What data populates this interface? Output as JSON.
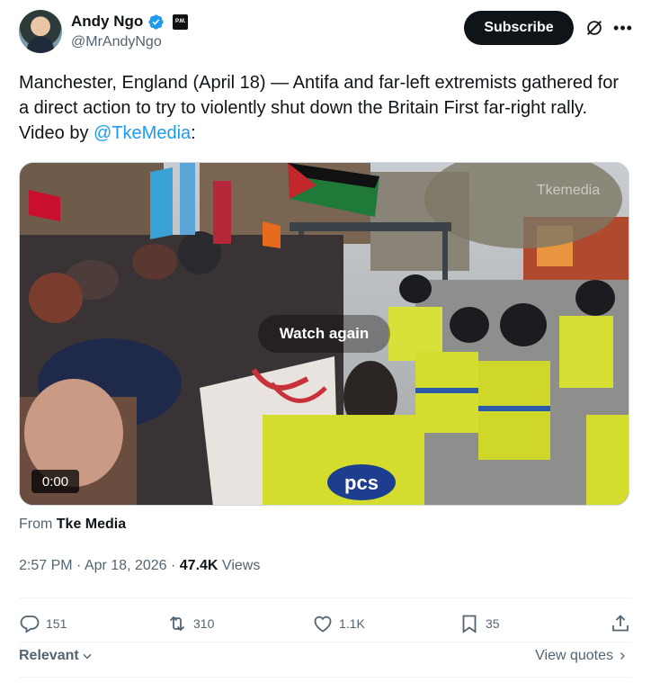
{
  "author": {
    "display_name": "Andy Ngo",
    "handle": "@MrAndyNgo",
    "affiliate_badge": "P.M."
  },
  "header": {
    "subscribe_label": "Subscribe"
  },
  "tweet": {
    "text_before_mention": "Manchester, England (April 18) — Antifa and far-left extremists gathered for a direct action to try to violently shut down the Britain First far-right rally. Video by ",
    "mention": "@TkeMedia",
    "text_after_mention": ":"
  },
  "media": {
    "watch_again_label": "Watch again",
    "duration": "0:00",
    "watermark": "Tkemedia",
    "vest_text": "pcs"
  },
  "source": {
    "prefix": "From ",
    "name": "Tke Media"
  },
  "meta": {
    "time": "2:57 PM",
    "separator1": " · ",
    "date": "Apr 18, 2026",
    "separator2": " · ",
    "views_count": "47.4K",
    "views_label": " Views"
  },
  "actions": {
    "replies": "151",
    "reposts": "310",
    "likes": "1.1K",
    "bookmarks": "35"
  },
  "footer": {
    "sort_label": "Relevant",
    "view_quotes_label": "View quotes"
  },
  "colors": {
    "accent": "#1d9bf0",
    "text_primary": "#0f1419",
    "text_secondary": "#536471"
  }
}
